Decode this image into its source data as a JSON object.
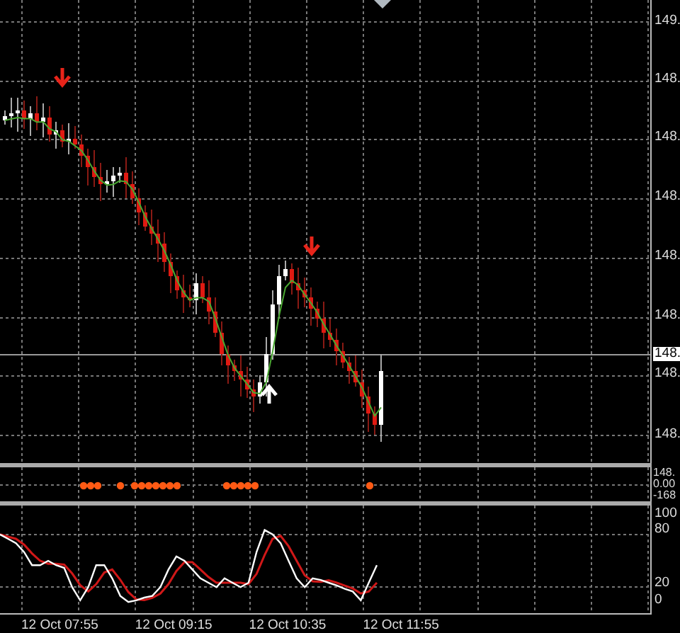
{
  "price_axis": [
    {
      "kind": "tick",
      "text": "149."
    },
    {
      "kind": "tick",
      "text": "148."
    },
    {
      "kind": "tick",
      "text": "148."
    },
    {
      "kind": "tick",
      "text": "148."
    },
    {
      "kind": "tick",
      "text": "148."
    },
    {
      "kind": "tick",
      "text": "148."
    },
    {
      "kind": "current",
      "text": "148."
    },
    {
      "kind": "tick",
      "text": "148."
    },
    {
      "kind": "tick",
      "text": "148."
    }
  ],
  "indicator_axis": [
    "148.",
    "0.00",
    "-168"
  ],
  "oscillator_axis": [
    "100",
    "80",
    "20",
    "0"
  ],
  "time_axis": [
    "12 Oct 07:55",
    "12 Oct 09:15",
    "12 Oct 10:35",
    "12 Oct 11:55"
  ]
}
